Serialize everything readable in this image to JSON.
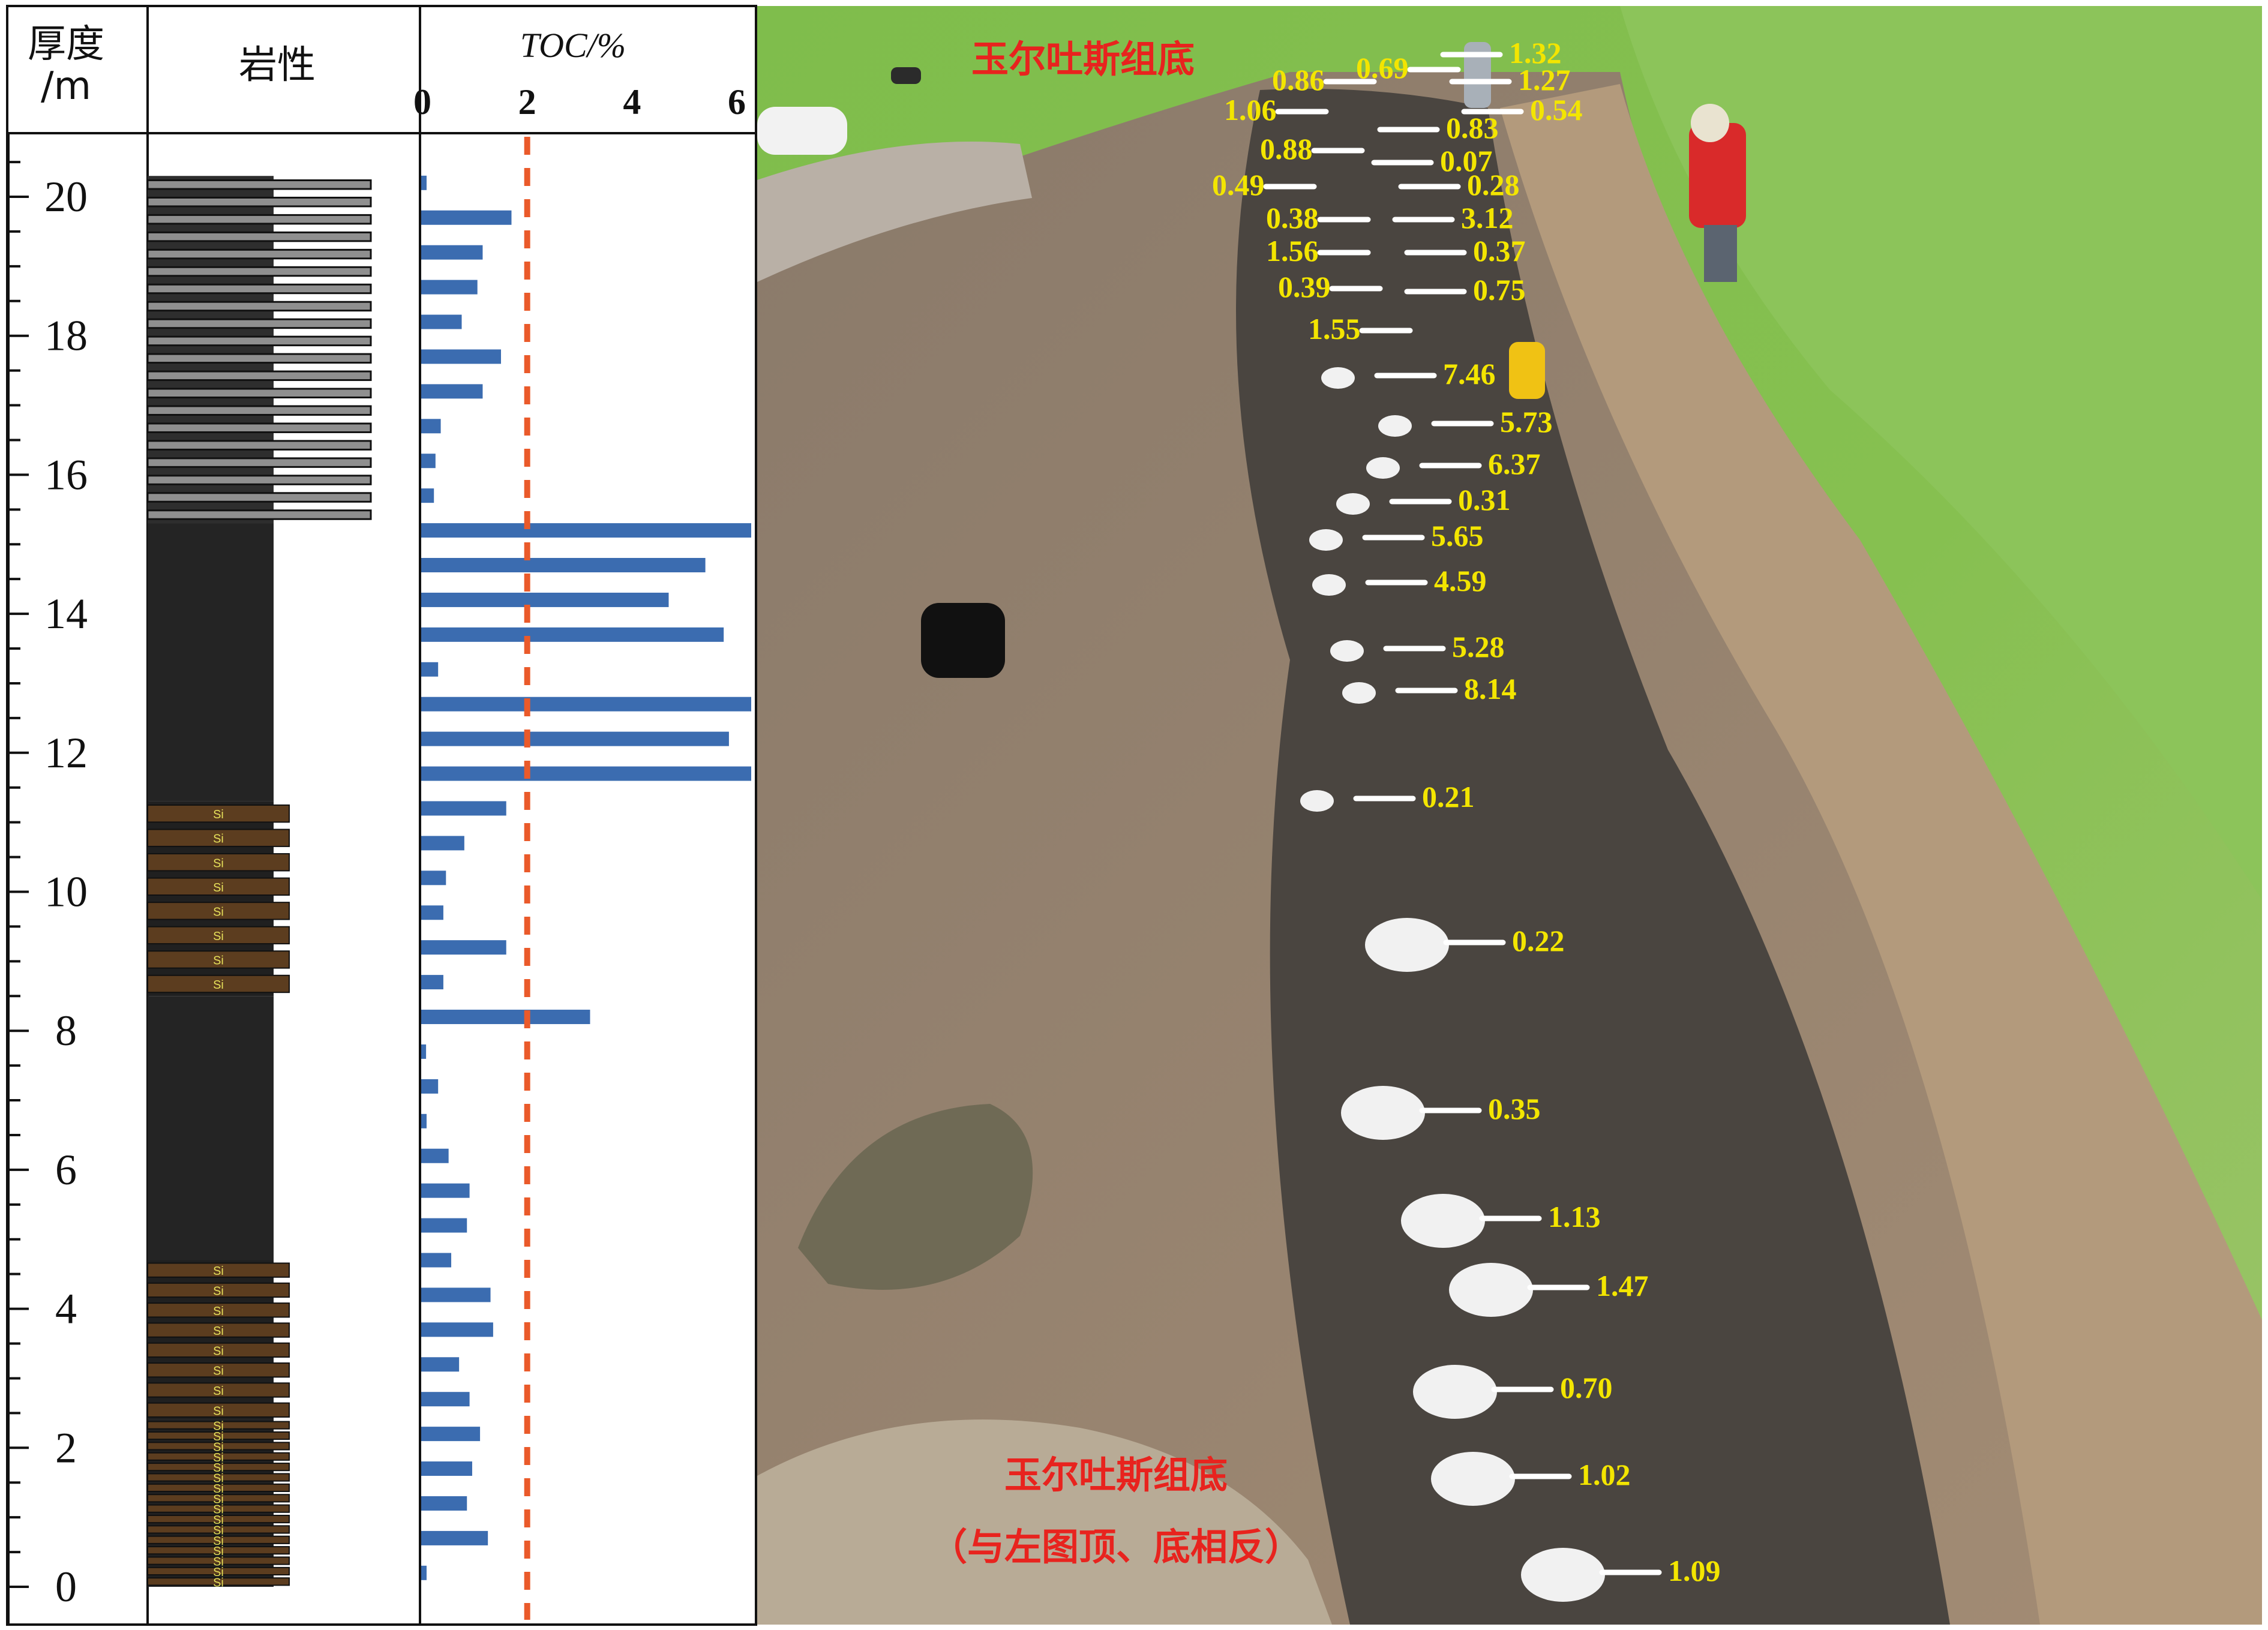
{
  "headers": {
    "thickness": "厚度",
    "thickness_unit": "/m",
    "lithology": "岩性",
    "toc": "TOC/%"
  },
  "labels": {
    "top_caption": "玉尔吐斯组底",
    "bottom_caption_1": "玉尔吐斯组底",
    "bottom_caption_2": "（与左图顶、底相反）",
    "si_symbol": "Si"
  },
  "colors": {
    "bar": "#3b6cb0",
    "threshold": "#ea5a2a",
    "shale": "#242424",
    "grey_layer": "#8f8f8f",
    "chert": "#5c3d1f",
    "chert_symbol": "#e6e05a",
    "photo_label": "#f3e500",
    "photo_caption": "#e8231e"
  },
  "chart_data": {
    "type": "bar",
    "orientation": "horizontal",
    "y_axis": {
      "label": "厚度 /m",
      "range": [
        0,
        21
      ],
      "ticks": [
        "0",
        "2",
        "4",
        "6",
        "8",
        "10",
        "12",
        "14",
        "16",
        "18",
        "20"
      ]
    },
    "x_axis": {
      "label": "TOC/%",
      "range": [
        0,
        6
      ],
      "ticks": [
        "0",
        "2",
        "4",
        "6"
      ]
    },
    "threshold": {
      "value": 2,
      "style": "dashed"
    },
    "series": [
      {
        "values": [
          {
            "depth": 20.2,
            "toc": 0.08
          },
          {
            "depth": 19.7,
            "toc": 1.7
          },
          {
            "depth": 19.2,
            "toc": 1.15
          },
          {
            "depth": 18.7,
            "toc": 1.05
          },
          {
            "depth": 18.2,
            "toc": 0.75
          },
          {
            "depth": 17.7,
            "toc": 1.5
          },
          {
            "depth": 17.2,
            "toc": 1.15
          },
          {
            "depth": 16.7,
            "toc": 0.35
          },
          {
            "depth": 16.2,
            "toc": 0.25
          },
          {
            "depth": 15.7,
            "toc": 0.22
          },
          {
            "depth": 15.2,
            "toc": 8.14,
            "label": "8.14"
          },
          {
            "depth": 14.7,
            "toc": 5.4
          },
          {
            "depth": 14.2,
            "toc": 4.7
          },
          {
            "depth": 13.7,
            "toc": 5.75
          },
          {
            "depth": 13.2,
            "toc": 0.3
          },
          {
            "depth": 12.7,
            "toc": 6.37,
            "label": "6.37"
          },
          {
            "depth": 12.2,
            "toc": 5.85
          },
          {
            "depth": 11.7,
            "toc": 7.46,
            "label": "7.46"
          },
          {
            "depth": 11.2,
            "toc": 1.6
          },
          {
            "depth": 10.7,
            "toc": 0.8
          },
          {
            "depth": 10.2,
            "toc": 0.45
          },
          {
            "depth": 9.7,
            "toc": 0.4
          },
          {
            "depth": 9.2,
            "toc": 1.6
          },
          {
            "depth": 8.7,
            "toc": 0.4
          },
          {
            "depth": 8.2,
            "toc": 3.2
          },
          {
            "depth": 7.7,
            "toc": 0.07
          },
          {
            "depth": 7.2,
            "toc": 0.3
          },
          {
            "depth": 6.7,
            "toc": 0.08
          },
          {
            "depth": 6.2,
            "toc": 0.5
          },
          {
            "depth": 5.7,
            "toc": 0.9
          },
          {
            "depth": 5.2,
            "toc": 0.85
          },
          {
            "depth": 4.7,
            "toc": 0.55
          },
          {
            "depth": 4.2,
            "toc": 1.3
          },
          {
            "depth": 3.7,
            "toc": 1.35
          },
          {
            "depth": 3.2,
            "toc": 0.7
          },
          {
            "depth": 2.7,
            "toc": 0.9
          },
          {
            "depth": 2.2,
            "toc": 1.1
          },
          {
            "depth": 1.7,
            "toc": 0.95
          },
          {
            "depth": 1.2,
            "toc": 0.85
          },
          {
            "depth": 0.7,
            "toc": 1.25
          },
          {
            "depth": 0.2,
            "toc": 0.08
          }
        ]
      }
    ],
    "lithology": {
      "intervals": [
        {
          "from": 0.0,
          "to": 2.4,
          "type": "chert_bedded"
        },
        {
          "from": 2.4,
          "to": 4.7,
          "type": "chert_interbedded"
        },
        {
          "from": 4.7,
          "to": 8.5,
          "type": "shale"
        },
        {
          "from": 8.5,
          "to": 11.3,
          "type": "chert_interbedded"
        },
        {
          "from": 11.3,
          "to": 15.3,
          "type": "shale"
        },
        {
          "from": 15.3,
          "to": 20.3,
          "type": "grey_interbedded"
        }
      ]
    },
    "photo_labels": [
      {
        "text": "0.86",
        "side": "left"
      },
      {
        "text": "0.69",
        "side": "left"
      },
      {
        "text": "1.32",
        "side": "right"
      },
      {
        "text": "1.27",
        "side": "right"
      },
      {
        "text": "1.06",
        "side": "left"
      },
      {
        "text": "0.54",
        "side": "right"
      },
      {
        "text": "0.83",
        "side": "right"
      },
      {
        "text": "0.88",
        "side": "left"
      },
      {
        "text": "0.07",
        "side": "right"
      },
      {
        "text": "0.49",
        "side": "left"
      },
      {
        "text": "0.28",
        "side": "right"
      },
      {
        "text": "0.38",
        "side": "left"
      },
      {
        "text": "3.12",
        "side": "right"
      },
      {
        "text": "1.56",
        "side": "left"
      },
      {
        "text": "0.37",
        "side": "right"
      },
      {
        "text": "0.39",
        "side": "left"
      },
      {
        "text": "0.75",
        "side": "right"
      },
      {
        "text": "1.55",
        "side": "left"
      },
      {
        "text": "7.46",
        "side": "right"
      },
      {
        "text": "5.73",
        "side": "right"
      },
      {
        "text": "6.37",
        "side": "right"
      },
      {
        "text": "0.31",
        "side": "right"
      },
      {
        "text": "5.65",
        "side": "right"
      },
      {
        "text": "4.59",
        "side": "right"
      },
      {
        "text": "5.28",
        "side": "right"
      },
      {
        "text": "8.14",
        "side": "right"
      },
      {
        "text": "0.21",
        "side": "right"
      },
      {
        "text": "0.22",
        "side": "right"
      },
      {
        "text": "0.35",
        "side": "right"
      },
      {
        "text": "1.13",
        "side": "right"
      },
      {
        "text": "1.47",
        "side": "right"
      },
      {
        "text": "0.70",
        "side": "right"
      },
      {
        "text": "1.02",
        "side": "right"
      },
      {
        "text": "1.09",
        "side": "right"
      }
    ]
  }
}
